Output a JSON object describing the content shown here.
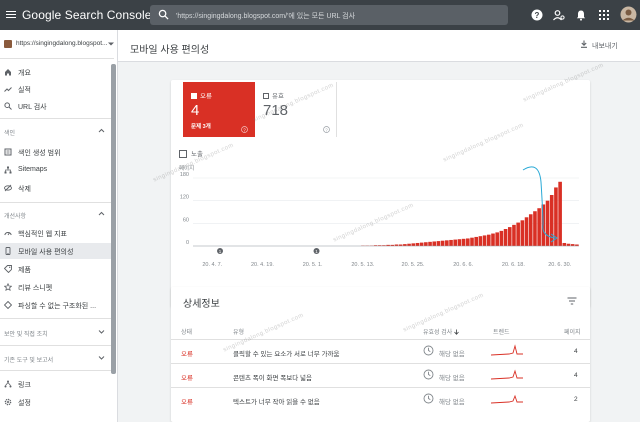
{
  "app": {
    "title": "Google Search Console",
    "search_placeholder": "'https://singingdalong.blogspot.com/'에 있는 모든 URL 검사"
  },
  "sidebar": {
    "property": "https://singingdalong.blogspot...",
    "nav_top": [
      {
        "label": "개요",
        "icon": "home-icon"
      },
      {
        "label": "실적",
        "icon": "trending-up-icon"
      },
      {
        "label": "URL 검사",
        "icon": "search-icon"
      }
    ],
    "section_index": "색인",
    "nav_index": [
      {
        "label": "색인 생성 범위",
        "icon": "coverage-icon"
      },
      {
        "label": "Sitemaps",
        "icon": "sitemap-icon"
      },
      {
        "label": "삭제",
        "icon": "remove-icon"
      }
    ],
    "section_enhance": "개선사항",
    "nav_enhance": [
      {
        "label": "핵심적인 웹 지표",
        "icon": "speed-icon"
      },
      {
        "label": "모바일 사용 편의성",
        "icon": "mobile-icon"
      },
      {
        "label": "제품",
        "icon": "product-icon"
      },
      {
        "label": "리뷰 스니펫",
        "icon": "review-icon"
      },
      {
        "label": "파싱할 수 없는 구조화된 ...",
        "icon": "structured-data-icon"
      }
    ],
    "section_security": "보안 및 직접 조치",
    "section_legacy": "기존 도구 및 보고서",
    "nav_bottom": [
      {
        "label": "링크",
        "icon": "links-icon"
      },
      {
        "label": "설정",
        "icon": "settings-icon"
      }
    ]
  },
  "header": {
    "page_title": "모바일 사용 편의성",
    "export_label": "내보내기"
  },
  "summary": {
    "error_label": "오류",
    "error_count": "4",
    "error_sub": "문제 3개",
    "valid_label": "유효",
    "valid_count": "718",
    "impressions_label": "노출"
  },
  "chart_data": {
    "type": "bar",
    "ylabel": "페이지",
    "ylim": [
      0,
      180
    ],
    "yticks": [
      "180",
      "120",
      "60",
      "0"
    ],
    "xticks": [
      "20. 4. 7.",
      "20. 4. 19.",
      "20. 5. 1.",
      "20. 5. 13.",
      "20. 5. 25.",
      "20. 6. 6.",
      "20. 6. 18.",
      "20. 6. 30."
    ],
    "x": [
      "20. 4. 3.",
      "20. 4. 4.",
      "20. 4. 5.",
      "20. 4. 6.",
      "20. 4. 7.",
      "20. 4. 8.",
      "20. 4. 9.",
      "20. 4. 10.",
      "20. 4. 11.",
      "20. 4. 12.",
      "20. 4. 13.",
      "20. 4. 14.",
      "20. 4. 15.",
      "20. 4. 16.",
      "20. 4. 17.",
      "20. 4. 18.",
      "20. 4. 19.",
      "20. 4. 20.",
      "20. 4. 21.",
      "20. 4. 22.",
      "20. 4. 23.",
      "20. 4. 24.",
      "20. 4. 25.",
      "20. 4. 26.",
      "20. 4. 27.",
      "20. 4. 28.",
      "20. 4. 29.",
      "20. 4. 30.",
      "20. 5. 1.",
      "20. 5. 2.",
      "20. 5. 3.",
      "20. 5. 4.",
      "20. 5. 5.",
      "20. 5. 6.",
      "20. 5. 7.",
      "20. 5. 8.",
      "20. 5. 9.",
      "20. 5. 10.",
      "20. 5. 11.",
      "20. 5. 12.",
      "20. 5. 13.",
      "20. 5. 14.",
      "20. 5. 15.",
      "20. 5. 16.",
      "20. 5. 17.",
      "20. 5. 18.",
      "20. 5. 19.",
      "20. 5. 20.",
      "20. 5. 21.",
      "20. 5. 22.",
      "20. 5. 23.",
      "20. 5. 24.",
      "20. 5. 25.",
      "20. 5. 26.",
      "20. 5. 27.",
      "20. 5. 28.",
      "20. 5. 29.",
      "20. 5. 30.",
      "20. 5. 31.",
      "20. 6. 1.",
      "20. 6. 2.",
      "20. 6. 3.",
      "20. 6. 4.",
      "20. 6. 5.",
      "20. 6. 6.",
      "20. 6. 7.",
      "20. 6. 8.",
      "20. 6. 9.",
      "20. 6. 10.",
      "20. 6. 11.",
      "20. 6. 12.",
      "20. 6. 13.",
      "20. 6. 14.",
      "20. 6. 15.",
      "20. 6. 16.",
      "20. 6. 17.",
      "20. 6. 18.",
      "20. 6. 19.",
      "20. 6. 20.",
      "20. 6. 21.",
      "20. 6. 22.",
      "20. 6. 23.",
      "20. 6. 24.",
      "20. 6. 25.",
      "20. 6. 26.",
      "20. 6. 27.",
      "20. 6. 28.",
      "20. 6. 29.",
      "20. 6. 30.",
      "20. 7. 1.",
      "20. 7. 2.",
      "20. 7. 3."
    ],
    "values": [
      0,
      0,
      0,
      0,
      0,
      0,
      0,
      0,
      0,
      0,
      0,
      0,
      0,
      0,
      0,
      0,
      0,
      0,
      0,
      0,
      0,
      0,
      0,
      0,
      0,
      0,
      0,
      0,
      0,
      0,
      0,
      0,
      0,
      0,
      0,
      0,
      0,
      0,
      0,
      0,
      1,
      1,
      1,
      2,
      2,
      2,
      3,
      3,
      4,
      4,
      5,
      6,
      7,
      8,
      9,
      10,
      11,
      12,
      13,
      14,
      15,
      16,
      17,
      18,
      19,
      20,
      22,
      24,
      26,
      28,
      30,
      33,
      36,
      40,
      45,
      50,
      56,
      62,
      68,
      76,
      84,
      92,
      100,
      110,
      120,
      135,
      155,
      170,
      8,
      6,
      5,
      4
    ],
    "color": "#d93025",
    "annotations": [
      "1",
      "1"
    ]
  },
  "details": {
    "title": "상세정보",
    "columns": {
      "status": "상태",
      "type": "유형",
      "validation": "유효성 검사",
      "trend": "트렌드",
      "pages": "페이지"
    },
    "rows": [
      {
        "status": "오류",
        "type": "클릭할 수 있는 요소가 서로 너무 가까움",
        "validation": "해당 없음",
        "pages": "4"
      },
      {
        "status": "오류",
        "type": "콘텐츠 폭이 화면 폭보다 넓음",
        "validation": "해당 없음",
        "pages": "4"
      },
      {
        "status": "오류",
        "type": "텍스트가 너무 작아 읽을 수 없음",
        "validation": "해당 없음",
        "pages": "2"
      }
    ]
  },
  "watermark": "singingdalong.blogspot.com"
}
